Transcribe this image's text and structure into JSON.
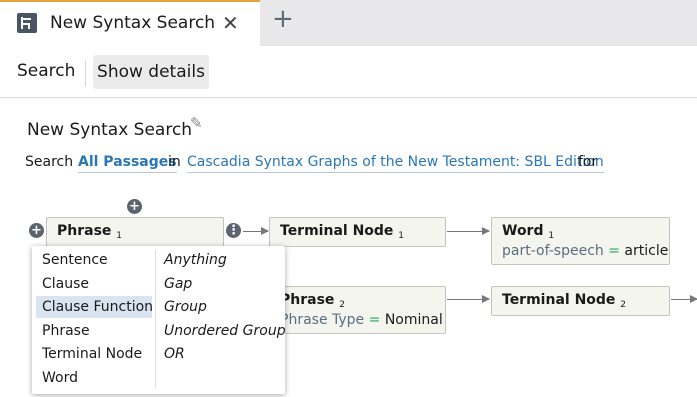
{
  "tab": {
    "title": "New Syntax Search",
    "close_glyph": "✕",
    "add_glyph": "+",
    "icon": "syntax-search-icon"
  },
  "toolbar": {
    "search_label": "Search",
    "details_label": "Show details"
  },
  "query": {
    "title": "New Syntax Search",
    "edit_icon": "pencil-icon",
    "prefix": "Search",
    "scope": "All Passages",
    "in_word": "in",
    "source": "Cascadia Syntax Graphs of the New Testament: SBL Edition",
    "suffix": "for"
  },
  "nodes": {
    "phrase1": {
      "title": "Phrase",
      "index": "1",
      "prop_partial": "Phrase Type = Nominal"
    },
    "terminal1": {
      "title": "Terminal Node",
      "index": "1"
    },
    "word1": {
      "title": "Word",
      "index": "1",
      "prop_key": "part-of-speech",
      "prop_eq": "=",
      "prop_val": "article"
    },
    "phrase2": {
      "title": "Phrase",
      "index": "2",
      "prop_key": "Phrase Type",
      "prop_eq": "=",
      "prop_val": "Nominal"
    },
    "terminal2": {
      "title": "Terminal Node",
      "index": "2"
    }
  },
  "buttons": {
    "add_glyph": "+",
    "more_glyph": "⋮"
  },
  "menu": {
    "left": [
      "Sentence",
      "Clause",
      "Clause Function",
      "Phrase",
      "Terminal Node",
      "Word"
    ],
    "right": [
      "Anything",
      "Gap",
      "Group",
      "Unordered Group",
      "OR"
    ],
    "selected": "Clause Function"
  }
}
